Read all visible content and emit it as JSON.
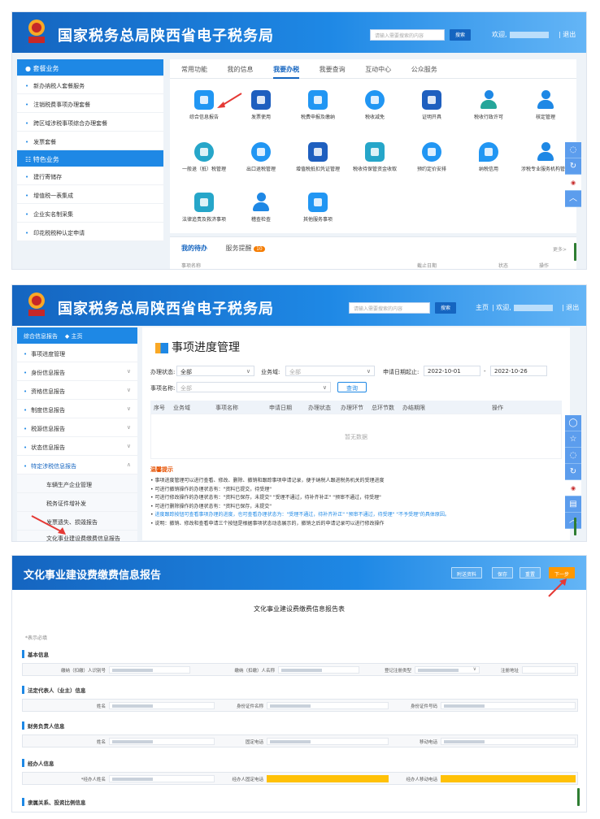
{
  "site": {
    "title": "国家税务总局陕西省电子税务局",
    "emblem_text": "中国税务",
    "search_placeholder": "请输入需要搜索的内容",
    "search_button": "搜索",
    "welcome": "欢迎,",
    "logout": "| 退出",
    "home": "主页",
    "welcome_comma": "| 欢迎,"
  },
  "panel1": {
    "sidebar_head": "套餐业务",
    "sidebar_items": [
      "新办纳税人套餐服务",
      "注销税费事项办理套餐",
      "跨区域涉税事项综合办理套餐",
      "发票套餐"
    ],
    "sidebar_head2": "特色业务",
    "sidebar_items2": [
      "建行寄储存",
      "增值税一表集成",
      "企业实名制采集",
      "印花税税种认定申请"
    ],
    "tabs": [
      "常用功能",
      "我的信息",
      "我要办税",
      "我要查询",
      "互动中心",
      "公众服务"
    ],
    "services": [
      "综合信息报告",
      "发票使用",
      "税费申报及缴纳",
      "税收减免",
      "证明开具",
      "税收行政许可",
      "核定管理",
      "一般退（抵）税管理",
      "出口退税管理",
      "增值税抵扣凭证管理",
      "税收待保管资金收取",
      "预约定价安排",
      "纳税信用",
      "涉税专业服务机构管理",
      "法律追责及救济事项",
      "稽查检查",
      "其他服务事项"
    ],
    "todo_tab": "我的待办",
    "notice_tab": "服务提醒",
    "notice_count": "10",
    "more": "更多>",
    "todo_cols": [
      "事项名称",
      "截止日期",
      "状态",
      "操作"
    ]
  },
  "panel2": {
    "sidebar_head": "综合信息报告",
    "sidebar_home": "主页",
    "sidebar_items": [
      "事项进度管理",
      "身份信息报告",
      "资格信息报告",
      "制度信息报告",
      "税源信息报告",
      "状态信息报告",
      "特定涉税信息报告"
    ],
    "sidebar_sub": [
      "车辆生产企业管理",
      "税务证件增补发",
      "发票遗失、损毁报告",
      "文化事业建设费缴费信息报告"
    ],
    "page_title": "事项进度管理",
    "filters": {
      "status_label": "办理状态:",
      "status_value": "全部",
      "domain_label": "业务域:",
      "domain_ph": "全部",
      "date_label": "申请日期起止:",
      "date_from": "2022-10-01",
      "date_sep": "-",
      "date_to": "2022-10-26",
      "item_label": "事项名称:",
      "item_ph": "全部",
      "query": "查询"
    },
    "columns": [
      "序号",
      "业务域",
      "事项名称",
      "申请日期",
      "办理状态",
      "办理环节",
      "总环节数",
      "办结期限",
      "操作"
    ],
    "empty": "暂无数据",
    "tips_title": "温馨提示",
    "tips": [
      "事项进度管理可以进行查看、修改、删除、撤销和跟踪事项申请记录，便于纳税人跟进税务机关的受理进度",
      "可进行撤销操作的办理状态有：\"资料已提交，待受理\"",
      "可进行修改操作的办理状态有：\"资料已保存，未提交\" \"受理不通过，待补齐补正\" \"预审不通过，待受理\"",
      "可进行删除操作的办理状态有：\"资料已保存，未提交\"",
      "进度跟踪按钮可查看事项办理的进度，也可查看办理状态为：\"受理不通过，待补齐补正\" \"预审不通过，待受理\" \"不予受理\"的具体原因。",
      "说明：撤销、修改和查看申请三个按钮是根据事项状态动态展示的，撤销之后的申请记录可以进行修改操作"
    ]
  },
  "panel3": {
    "title": "文化事业建设费缴费信息报告",
    "buttons": [
      "附送资料",
      "保存",
      "重置",
      "下一步"
    ],
    "form_title": "文化事业建设费缴费信息报告表",
    "required_note": "*表示必填",
    "sections": {
      "basic": "基本信息",
      "legal": "法定代表人（业主）信息",
      "finance": "财务负责人信息",
      "agent": "经办人信息",
      "relation": "隶属关系、投资比例信息"
    },
    "basic_labels": [
      "缴纳（扣缴）人识别号",
      "缴纳（扣缴）人名称",
      "登记注册类型",
      "注册地址"
    ],
    "legal_labels": [
      "姓名",
      "身份证件名称",
      "身份证件号码"
    ],
    "finance_labels": [
      "姓名",
      "固定电话",
      "移动电话"
    ],
    "agent_labels": [
      "*经办人姓名",
      "经办人固定电话",
      "经办人移动电话"
    ]
  },
  "colors": {
    "brand_blue": "#1565c0",
    "accent_blue": "#1e88e5",
    "next_orange": "#ff9800",
    "required_yellow": "#ffc107",
    "arrow_red": "#e53935"
  }
}
